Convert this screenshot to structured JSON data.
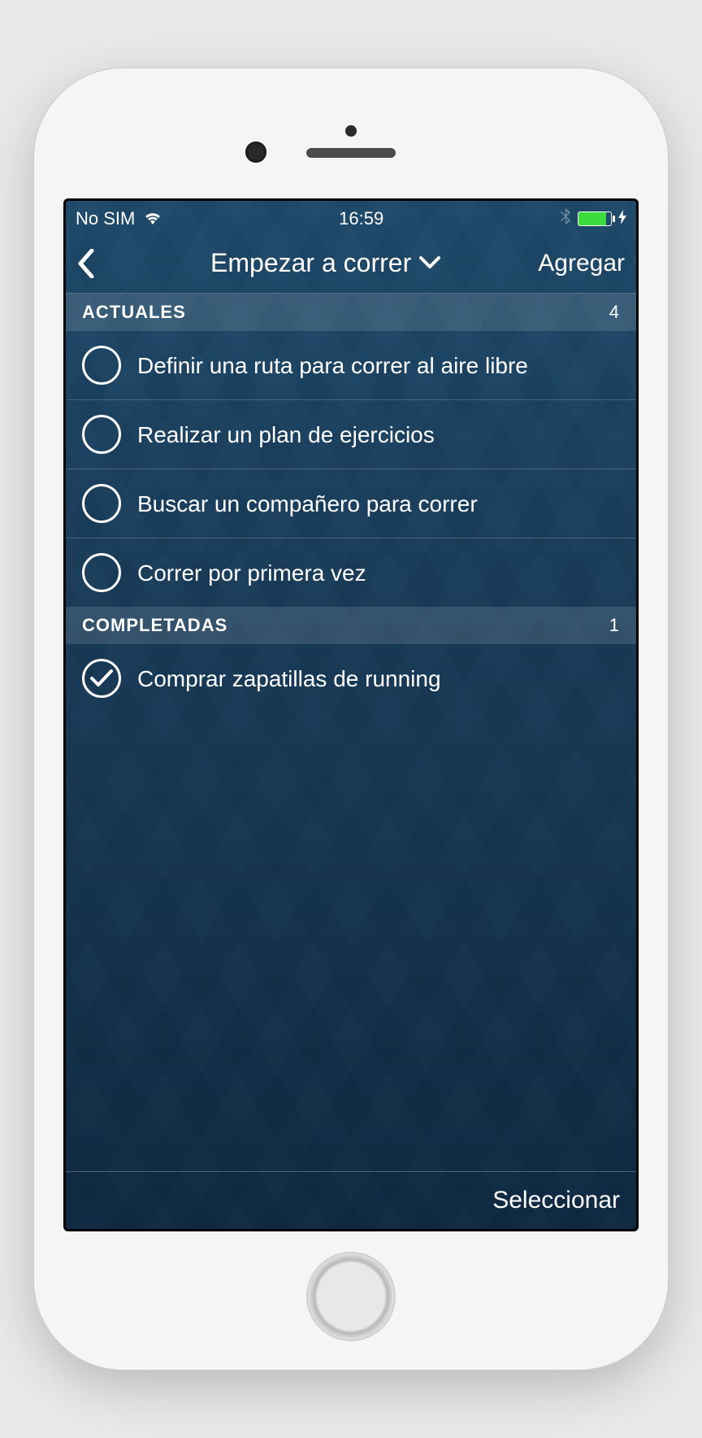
{
  "status": {
    "carrier": "No SIM",
    "time": "16:59"
  },
  "nav": {
    "title": "Empezar a correr",
    "add_label": "Agregar"
  },
  "sections": {
    "current": {
      "label": "ACTUALES",
      "count": "4",
      "items": [
        {
          "text": "Definir una ruta para correr al aire libre",
          "done": false
        },
        {
          "text": "Realizar un plan de ejercicios",
          "done": false
        },
        {
          "text": "Buscar un compañero para correr",
          "done": false
        },
        {
          "text": "Correr por primera vez",
          "done": false
        }
      ]
    },
    "completed": {
      "label": "COMPLETADAS",
      "count": "1",
      "items": [
        {
          "text": "Comprar zapatillas de running",
          "done": true
        }
      ]
    }
  },
  "footer": {
    "select_label": "Seleccionar"
  }
}
